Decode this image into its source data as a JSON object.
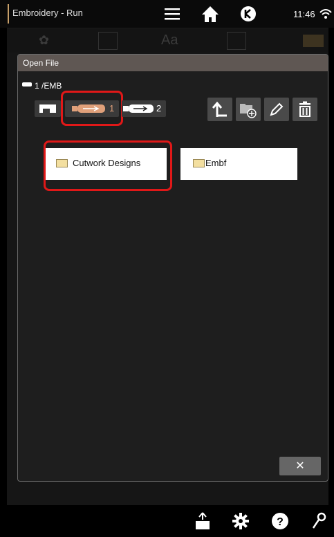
{
  "status_bar": {
    "app_title": "Embroidery - Run",
    "time": "11:46"
  },
  "background_toolbar": {
    "text_tool_label": "Aa"
  },
  "dialog": {
    "title": "Open File",
    "path": "1 /EMB",
    "devices": {
      "usb1_label": "1",
      "usb2_label": "2"
    },
    "folders": [
      {
        "name": "Cutwork Designs"
      },
      {
        "name": "Embf"
      }
    ],
    "close_glyph": "✕"
  },
  "accent_colors": {
    "highlight": "#e01818",
    "active_usb": "#e0a07a"
  }
}
